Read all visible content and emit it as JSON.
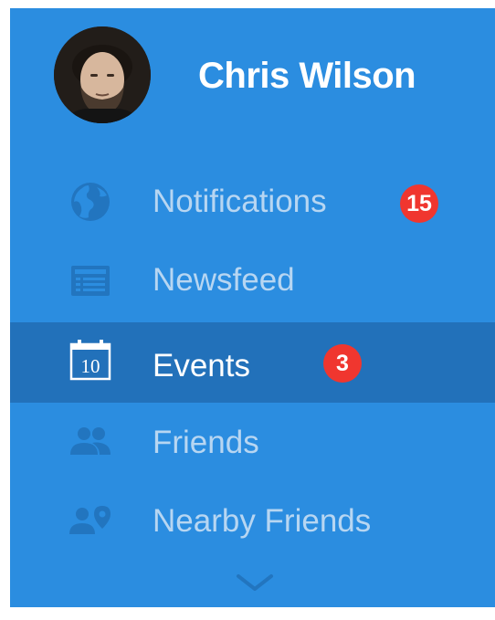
{
  "profile": {
    "name": "Chris Wilson"
  },
  "menu": {
    "items": [
      {
        "label": "Notifications",
        "icon": "globe-icon",
        "badge": "15"
      },
      {
        "label": "Newsfeed",
        "icon": "newsfeed-icon"
      },
      {
        "label": "Events",
        "icon": "calendar-icon",
        "calendar_day": "10",
        "badge": "3",
        "active": true
      },
      {
        "label": "Friends",
        "icon": "friends-icon"
      },
      {
        "label": "Nearby Friends",
        "icon": "nearby-friends-icon"
      }
    ],
    "more_icon": "chevron-down-icon"
  },
  "colors": {
    "panel_background": "#2b8de0",
    "active_background": "#2271ba",
    "inactive_text": "#b7d6f2",
    "active_text": "#ffffff",
    "inactive_icon": "#2275bf",
    "badge": "#f0362f"
  }
}
